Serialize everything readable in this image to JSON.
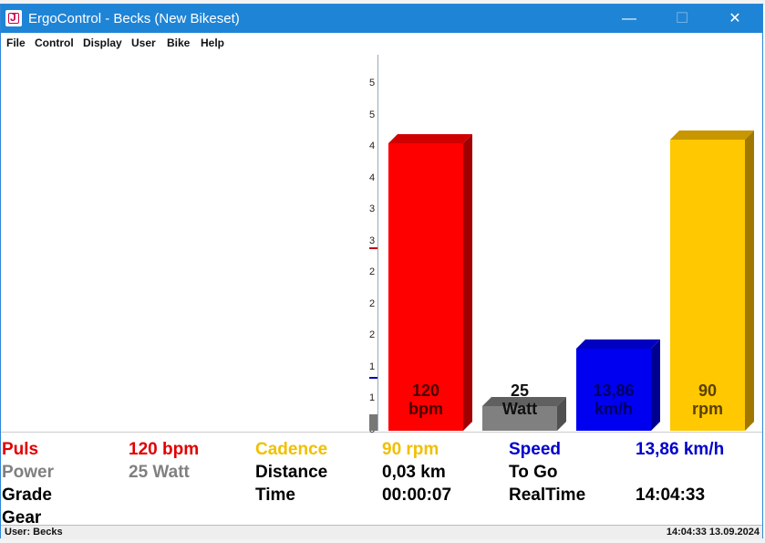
{
  "window": {
    "title": "ErgoControl - Becks (New Bikeset)"
  },
  "window_controls": {
    "minimize": "—",
    "maximize": "☐",
    "close": "✕"
  },
  "menu": [
    "File",
    "Control",
    "Display",
    "User",
    "Bike",
    "Help"
  ],
  "left_axis": {
    "tick_labels": [
      "5",
      "5",
      "4",
      "4",
      "3",
      "3",
      "2",
      "2",
      "2",
      "1",
      "1",
      "5"
    ],
    "marker_colors": {
      "red": "#c00000",
      "blue": "#0000aa",
      "gray": "#777777"
    }
  },
  "bars": [
    {
      "id": "puls",
      "value": 120,
      "value_label": "120",
      "unit": "bpm",
      "fraction": 0.77,
      "color": "#ff0000",
      "side": "#a00000",
      "top": "#d00000",
      "text_color": "#4a0000"
    },
    {
      "id": "power",
      "value": 25,
      "value_label": "25",
      "unit": "Watt",
      "fraction": 0.065,
      "color": "#808080",
      "side": "#505050",
      "top": "#606060",
      "text_color": "#111111"
    },
    {
      "id": "speed",
      "value": 13.86,
      "value_label": "13,86",
      "unit": "km/h",
      "fraction": 0.22,
      "color": "#0000f0",
      "side": "#000090",
      "top": "#0000c0",
      "text_color": "#000060"
    },
    {
      "id": "cadence",
      "value": 90,
      "value_label": "90",
      "unit": "rpm",
      "fraction": 0.78,
      "color": "#ffc800",
      "side": "#a07800",
      "top": "#c89600",
      "text_color": "#5a4000"
    }
  ],
  "stats": {
    "puls": {
      "label": "Puls",
      "value": "120 bpm",
      "color": "#e00000"
    },
    "cadence": {
      "label": "Cadence",
      "value": "90 rpm",
      "color": "#f0c000"
    },
    "speed": {
      "label": "Speed",
      "value": "13,86 km/h",
      "color": "#0000cc"
    },
    "power": {
      "label": "Power",
      "value": "25 Watt",
      "color": "#808080"
    },
    "distance": {
      "label": "Distance",
      "value": "0,03 km",
      "color": "#000000"
    },
    "to_go": {
      "label": "To Go",
      "value": "",
      "color": "#000000"
    },
    "grade": {
      "label": "Grade",
      "value": "",
      "color": "#000000"
    },
    "time": {
      "label": "Time",
      "value": "00:00:07",
      "color": "#000000"
    },
    "realtime": {
      "label": "RealTime",
      "value": "14:04:33",
      "color": "#000000"
    },
    "gear": {
      "label": "Gear",
      "value": "",
      "color": "#000000"
    }
  },
  "statusbar": {
    "user": "User: Becks",
    "datetime": "14:04:33 13.09.2024"
  }
}
